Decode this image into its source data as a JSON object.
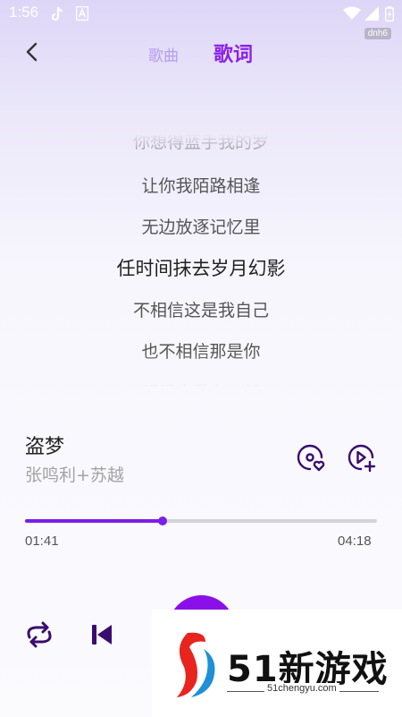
{
  "status_bar": {
    "time": "1:56",
    "icons": [
      "tiktok-icon",
      "a-icon",
      "wifi-icon",
      "signal-icon",
      "battery-icon"
    ]
  },
  "watermark": "dnh6",
  "header": {
    "back_icon": "chevron-left-icon",
    "tabs": [
      {
        "label": "歌曲",
        "active": false
      },
      {
        "label": "歌词",
        "active": true
      }
    ]
  },
  "lyrics": {
    "lines": [
      {
        "text": "你想得蓝手我的罗",
        "active": false
      },
      {
        "text": "让你我陌路相逢",
        "active": false
      },
      {
        "text": "无边放逐记忆里",
        "active": false
      },
      {
        "text": "任时间抹去岁月幻影",
        "active": true
      },
      {
        "text": "不相信这是我自己",
        "active": false
      },
      {
        "text": "也不相信那是你",
        "active": false
      },
      {
        "text": "明明应看在一起",
        "active": false
      }
    ]
  },
  "song": {
    "title": "盗梦",
    "artist": "张鸣利+苏越"
  },
  "actions": {
    "favorite_icon": "disc-heart-icon",
    "add_to_playlist_icon": "play-add-icon"
  },
  "progress": {
    "current": "01:41",
    "total": "04:18",
    "fraction": 0.392
  },
  "controls": {
    "repeat_icon": "repeat-icon",
    "previous_icon": "skip-previous-icon",
    "play_icon": "play-icon"
  },
  "ad": {
    "logo_icon": "51-logo-icon",
    "title": "51新游戏",
    "url": "51chengyu.com"
  },
  "colors": {
    "accent": "#8a21e8",
    "progress": "#7b1fe6",
    "inactive_tab": "#b79cf0",
    "icon": "#3a0c6e"
  }
}
